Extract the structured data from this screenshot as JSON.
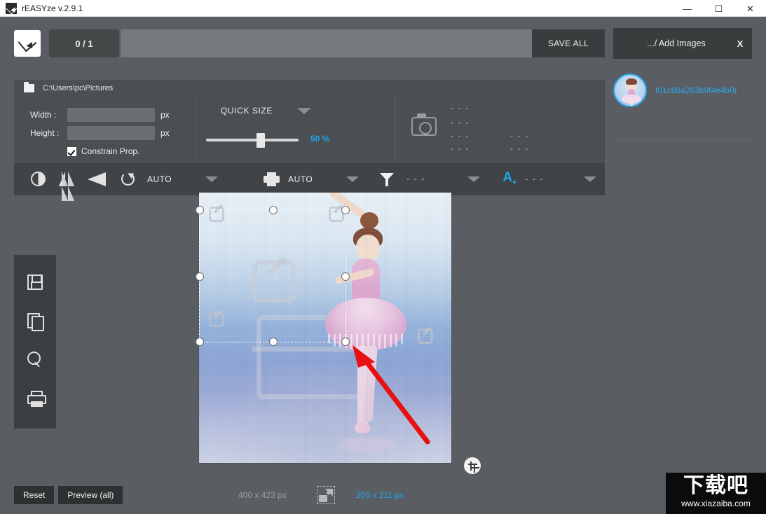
{
  "window": {
    "title": "rEASYze v.2.9.1",
    "app_icon": "resize-arrow-icon",
    "minimize": "—",
    "maximize": "☐",
    "close": "✕"
  },
  "toolbar": {
    "logo_icon": "resize-arrow-icon",
    "counter": "0 / 1",
    "save_all_label": "SAVE ALL"
  },
  "path_bar": {
    "folder_icon": "folder-icon",
    "path": "C:\\Users\\pc\\Pictures"
  },
  "size_panel": {
    "width_label": "Width :",
    "width_value": "",
    "width_placeholder": "",
    "height_label": "Height :",
    "height_value": "",
    "height_placeholder": "",
    "unit": "px",
    "constrain_label": "Constrain Prop.",
    "constrain_checked": true,
    "quick_size_label": "QUICK SIZE",
    "quick_size_caret": "chevron-down-icon",
    "slider_value": "50 %",
    "slider_percent": 50
  },
  "exif": {
    "camera_icon": "camera-icon",
    "line1": "- - -",
    "line2": "- - -",
    "line3": "- - -",
    "line4": "- - -",
    "line5": "- - -",
    "line6": "- - -"
  },
  "tools": {
    "contrast_icon": "contrast-icon",
    "flip_horizontal_icon": "flip-horizontal-icon",
    "flip_vertical_icon": "flip-vertical-icon",
    "rotate_icon": "rotate-icon",
    "rotate_label": "AUTO",
    "rotate_caret": "chevron-down-icon",
    "print_icon": "printer-icon",
    "print_label": "AUTO",
    "print_caret": "chevron-down-icon",
    "filter_icon": "funnel-icon",
    "filter_value": "- - -",
    "filter_caret": "chevron-down-icon",
    "watermark_icon": "text-watermark-icon",
    "watermark_letter": "A",
    "watermark_plus": "+",
    "watermark_value": "- - -",
    "watermark_caret": "chevron-down-icon"
  },
  "rail": {
    "save_icon": "floppy-save-icon",
    "copy_icon": "copy-pages-icon",
    "zoom_icon": "magnifier-icon",
    "print_icon": "printer-icon"
  },
  "canvas": {
    "crop_fab_icon": "crop-icon",
    "annotation_arrow": "red-arrow-annotation",
    "handles": [
      "tl",
      "tc",
      "tr",
      "ml",
      "mr",
      "bl",
      "bc",
      "br"
    ]
  },
  "bottom_bar": {
    "reset_label": "Reset",
    "preview_label": "Preview (all)",
    "original_size": "400 x 423 px",
    "resize_icon": "resize-arrow-box-icon",
    "new_size": "200 x 211 px"
  },
  "right_panel": {
    "add_images_label": ".../ Add Images",
    "close_label": "X",
    "items": [
      {
        "thumb_icon": "ballerina-thumbnail",
        "name": "t01c88a263b9f4e4b0("
      }
    ]
  },
  "corner_watermark": {
    "logo_text": "下载吧",
    "url": "www.xiazaiba.com"
  },
  "colors": {
    "accent_blue": "#1ca7ea",
    "panel_bg": "#4c4f52",
    "app_bg": "#5a5e62",
    "dark_btn": "#3a3d3e",
    "red_arrow": "#e81010"
  }
}
